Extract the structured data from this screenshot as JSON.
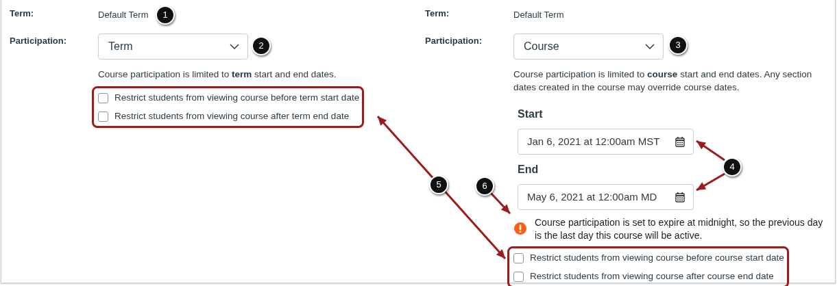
{
  "panels": [
    {
      "term_label": "Term:",
      "term_value": "Default Term",
      "participation_label": "Participation:",
      "participation": "Term",
      "description": "Course participation is limited to **term** start and end dates.",
      "checkboxes": [
        {
          "label": "Restrict students from viewing course before term start date",
          "checked": false
        },
        {
          "label": "Restrict students from viewing course after term end date",
          "checked": false
        }
      ]
    },
    {
      "term_label": "Term:",
      "term_value": "Default Term",
      "participation_label": "Participation:",
      "participation": "Course",
      "description": "Course participation is limited to **course** start and end dates. Any section dates created in the course may override course dates.",
      "dates": [
        {
          "label": "Start",
          "value": "Jan 6, 2021 at 12:00am MST"
        },
        {
          "label": "End",
          "value": "May 6, 2021 at 12:00am MD"
        }
      ],
      "warning": "Course participation is set to expire at midnight, so the previous day is the last day this course will be active.",
      "checkboxes": [
        {
          "label": "Restrict students from viewing course before course start date",
          "checked": false
        },
        {
          "label": "Restrict students from viewing course after course end date",
          "checked": false
        }
      ]
    }
  ],
  "callouts": [
    {
      "label": "1"
    },
    {
      "label": "2"
    },
    {
      "label": "3"
    },
    {
      "label": "4"
    },
    {
      "label": "5"
    },
    {
      "label": "6"
    }
  ]
}
